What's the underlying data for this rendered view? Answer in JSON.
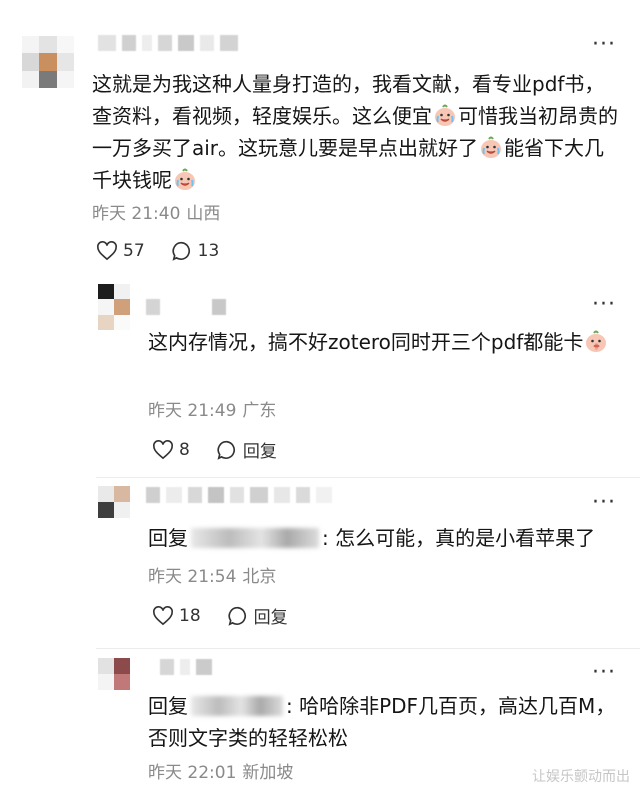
{
  "comments": [
    {
      "text_parts": [
        "这就是为我这种人量身打造的，我看文献，看专业pdf书，查资料，看视频，轻度娱乐。这么便宜",
        "可惜我当初昂贵的一万多买了air。这玩意儿要是早点出就好了",
        "能省下大几千块钱呢",
        ""
      ],
      "time": "昨天 21:40",
      "location": "山西",
      "likes": "57",
      "replies": "13"
    },
    {
      "text_parts": [
        "这内存情况，搞不好zotero同时开三个pdf都能卡",
        ""
      ],
      "time": "昨天 21:49",
      "location": "广东",
      "likes": "8",
      "reply_label": "回复"
    },
    {
      "reply_prefix": "回复",
      "text": ": 怎么可能，真的是小看苹果了",
      "time": "昨天 21:54",
      "location": "北京",
      "likes": "18",
      "reply_label": "回复"
    },
    {
      "reply_prefix": "回复",
      "text": ": 哈哈除非PDF几百页，高达几百M，否则文字类的轻轻松松",
      "time": "昨天 22:01",
      "location": "新加坡"
    }
  ],
  "more_label": "···",
  "watermark": "让娱乐颤动而出",
  "icons": {
    "like": "heart-outline-icon",
    "comment": "speech-bubble-icon",
    "more": "more-dots-icon",
    "emoji": "crying-laughing-peach-emoji"
  }
}
